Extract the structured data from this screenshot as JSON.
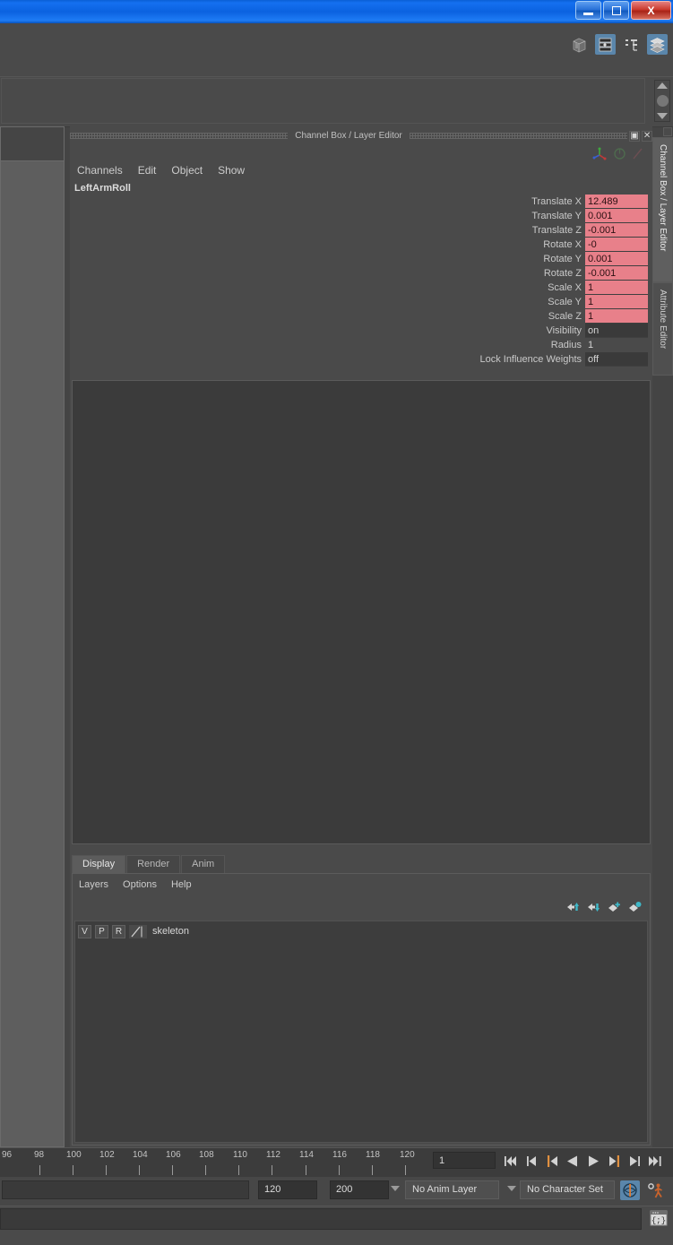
{
  "window": {
    "minimize_label": "Minimize",
    "maximize_label": "Restore",
    "close_label": "X"
  },
  "toolbar": {
    "icons": [
      {
        "name": "modeling-toolkit-icon",
        "label": ""
      },
      {
        "name": "hypergraph-icon",
        "label": ""
      },
      {
        "name": "outliner-icon",
        "label": ""
      },
      {
        "name": "channel-box-layer-editor-icon",
        "label": ""
      }
    ]
  },
  "channel_box": {
    "title": "Channel Box / Layer Editor",
    "restore_label": "▣",
    "close_label": "✕",
    "menus": [
      "Channels",
      "Edit",
      "Object",
      "Show"
    ],
    "object_name": "LeftArmRoll",
    "tool_icons": [
      "manipulator-axis-icon",
      "circle-icon",
      "slash-icon"
    ],
    "rows": [
      {
        "label": "Translate X",
        "value": "12.489",
        "state": "keyed"
      },
      {
        "label": "Translate Y",
        "value": "0.001",
        "state": "keyed"
      },
      {
        "label": "Translate Z",
        "value": "-0.001",
        "state": "keyed"
      },
      {
        "label": "Rotate X",
        "value": "-0",
        "state": "keyed"
      },
      {
        "label": "Rotate Y",
        "value": "0.001",
        "state": "keyed"
      },
      {
        "label": "Rotate Z",
        "value": "-0.001",
        "state": "keyed"
      },
      {
        "label": "Scale X",
        "value": "1",
        "state": "keyed"
      },
      {
        "label": "Scale Y",
        "value": "1",
        "state": "keyed"
      },
      {
        "label": "Scale Z",
        "value": "1",
        "state": "keyed"
      },
      {
        "label": "Visibility",
        "value": "on",
        "state": "plain"
      },
      {
        "label": "Radius",
        "value": "1",
        "state": "dark"
      },
      {
        "label": "Lock Influence Weights",
        "value": "off",
        "state": "plain"
      }
    ]
  },
  "layer_editor": {
    "tabs": [
      {
        "label": "Display",
        "active": true
      },
      {
        "label": "Render",
        "active": false
      },
      {
        "label": "Anim",
        "active": false
      }
    ],
    "menus": [
      "Layers",
      "Options",
      "Help"
    ],
    "toolbar_icons": [
      "move-layer-up-icon",
      "move-layer-down-icon",
      "create-layer-from-selected-icon",
      "create-new-layer-icon"
    ],
    "layers": [
      {
        "visibility": "V",
        "playback": "P",
        "reference": "R",
        "name": "skeleton"
      }
    ]
  },
  "timeline": {
    "ticks": [
      "96",
      "98",
      "100",
      "102",
      "104",
      "106",
      "108",
      "110",
      "112",
      "114",
      "116",
      "118",
      "120"
    ],
    "current_frame": "1",
    "transport": [
      {
        "name": "go-to-start-button",
        "glyph": "⏮"
      },
      {
        "name": "step-back-keyframe-button",
        "glyph": "⏮"
      },
      {
        "name": "step-back-frame-button",
        "glyph": "⏮"
      },
      {
        "name": "play-backwards-button",
        "glyph": "◀"
      },
      {
        "name": "play-forwards-button",
        "glyph": "▶"
      },
      {
        "name": "step-forward-frame-button",
        "glyph": "⏭"
      },
      {
        "name": "step-forward-keyframe-button",
        "glyph": "⏭"
      },
      {
        "name": "go-to-end-button",
        "glyph": "⏭"
      }
    ]
  },
  "statusbar": {
    "range_end": "120",
    "playback_end": "200",
    "anim_layer": "No Anim Layer",
    "character_set": "No Character Set",
    "auto_keyframe_icon": "auto-keyframe-icon",
    "animation_preferences_icon": "animation-preferences-icon"
  },
  "bottom": {
    "command_line_value": "",
    "script_editor_icon": "script-editor-icon"
  },
  "right_tabs": [
    {
      "label": "Channel Box / Layer Editor",
      "active": true
    },
    {
      "label": "Attribute Editor",
      "active": false
    }
  ],
  "colors": {
    "keyed_channel": "#e8808a",
    "title_bar": "#1570f0",
    "accent_select": "#5a86ab",
    "panel_bg": "#4a4a4a"
  }
}
